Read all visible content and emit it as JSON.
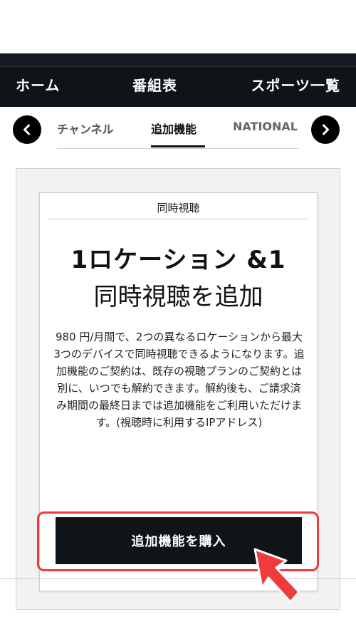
{
  "header": {
    "nav": {
      "home": "ホーム",
      "guide": "番組表",
      "sports": "スポーツ一覧"
    }
  },
  "tabs": {
    "items": [
      {
        "label": "チャンネル"
      },
      {
        "label": "追加機能"
      },
      {
        "label": "NATIONAL"
      }
    ],
    "active": "追加機能",
    "prev_icon": "chevron-left-icon",
    "next_icon": "chevron-right-icon"
  },
  "card": {
    "label": "同時視聴",
    "title_line1": "1ロケーション &1",
    "title_line2": "同時視聴を追加",
    "description": "980 円/月間で、2つの異なるロケーションから最大3つのデバイスで同時視聴できるようになります。追加機能のご契約は、既存の視聴プランのご契約とは別に、いつでも解約できます。解約後も、ご請求済み期間の最終日までは追加機能をご利用いただけます。(視聴時に利用するIPアドレス)",
    "button": "追加機能を購入"
  },
  "colors": {
    "header_bg": "#0f1419",
    "highlight": "#ee3b3b",
    "button_bg": "#0f1419"
  }
}
